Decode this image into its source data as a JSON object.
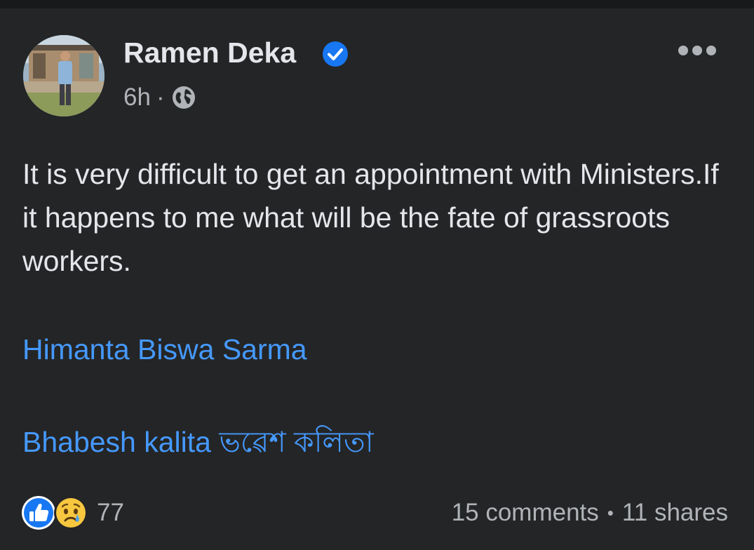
{
  "post": {
    "author": "Ramen Deka",
    "time": "6h",
    "meta_separator": "·",
    "audience_icon": "globe-icon",
    "verified_icon": "verified-badge-icon",
    "menu_icon": "more-options-icon",
    "text": "It is very difficult to get an appointment with Ministers.If it happens to me what will be the fate of grassroots workers.",
    "mentions": [
      "Himanta Biswa Sarma",
      "Bhabesh kalita ভৱেশ কলিতা"
    ],
    "reactions": {
      "icons": [
        "like-icon",
        "sad-icon"
      ],
      "count": "77"
    },
    "comments": "15 comments",
    "stats_separator": "•",
    "shares": "11 shares"
  },
  "colors": {
    "background": "#242526",
    "text_primary": "#e4e6eb",
    "text_secondary": "#b0b3b8",
    "link": "#4599ff",
    "verified": "#1877f2"
  }
}
